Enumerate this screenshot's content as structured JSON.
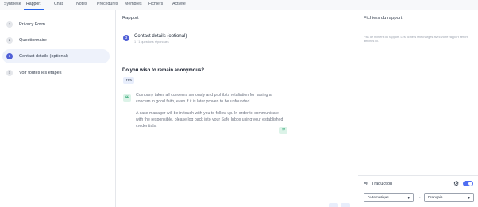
{
  "topnav": {
    "tabs": [
      {
        "label": "Synthèse"
      },
      {
        "label": "Rapport"
      },
      {
        "label": "Chat"
      },
      {
        "label": "Notes"
      },
      {
        "label": "Procédures"
      },
      {
        "label": "Membres"
      },
      {
        "label": "Fichiers"
      },
      {
        "label": "Activité"
      }
    ],
    "active_tab": "Rapport"
  },
  "steps": [
    {
      "number": "1",
      "label": "Privacy Form"
    },
    {
      "number": "2",
      "label": "Questionnaire"
    },
    {
      "number": "3",
      "label": "Contact details (optional)"
    },
    {
      "number": "",
      "label": "Voir toutes les étapes"
    }
  ],
  "report": {
    "title": "Rapport",
    "section": {
      "number": "3",
      "title": "Contact details (optional)",
      "subtitle": "1 / 1 questions répondues"
    },
    "question": "Do you wish to remain anonymous?",
    "answer": "Yes",
    "paragraph1": "Company takes all concerns seriously and prohibits retaliation for raising a concern in good faith, even if it is later proven to be unfounded.",
    "paragraph2": "A case manager will be in touch with you to follow up. In order to communicate with the responsible, please log back into your Safe Inbox using your established credentials."
  },
  "files": {
    "title": "Fichiers du rapport",
    "empty_text": "Pas de fichiers du rapport. Les fichiers téléchargés avec votre rapport seront affichés ici."
  },
  "translation": {
    "label": "Traduction",
    "enabled": true,
    "source": "Automatique",
    "target": "Français"
  },
  "colors": {
    "accent": "#4f5fd6",
    "quote": "#22a06b",
    "toggle": "#4f6ef2"
  }
}
